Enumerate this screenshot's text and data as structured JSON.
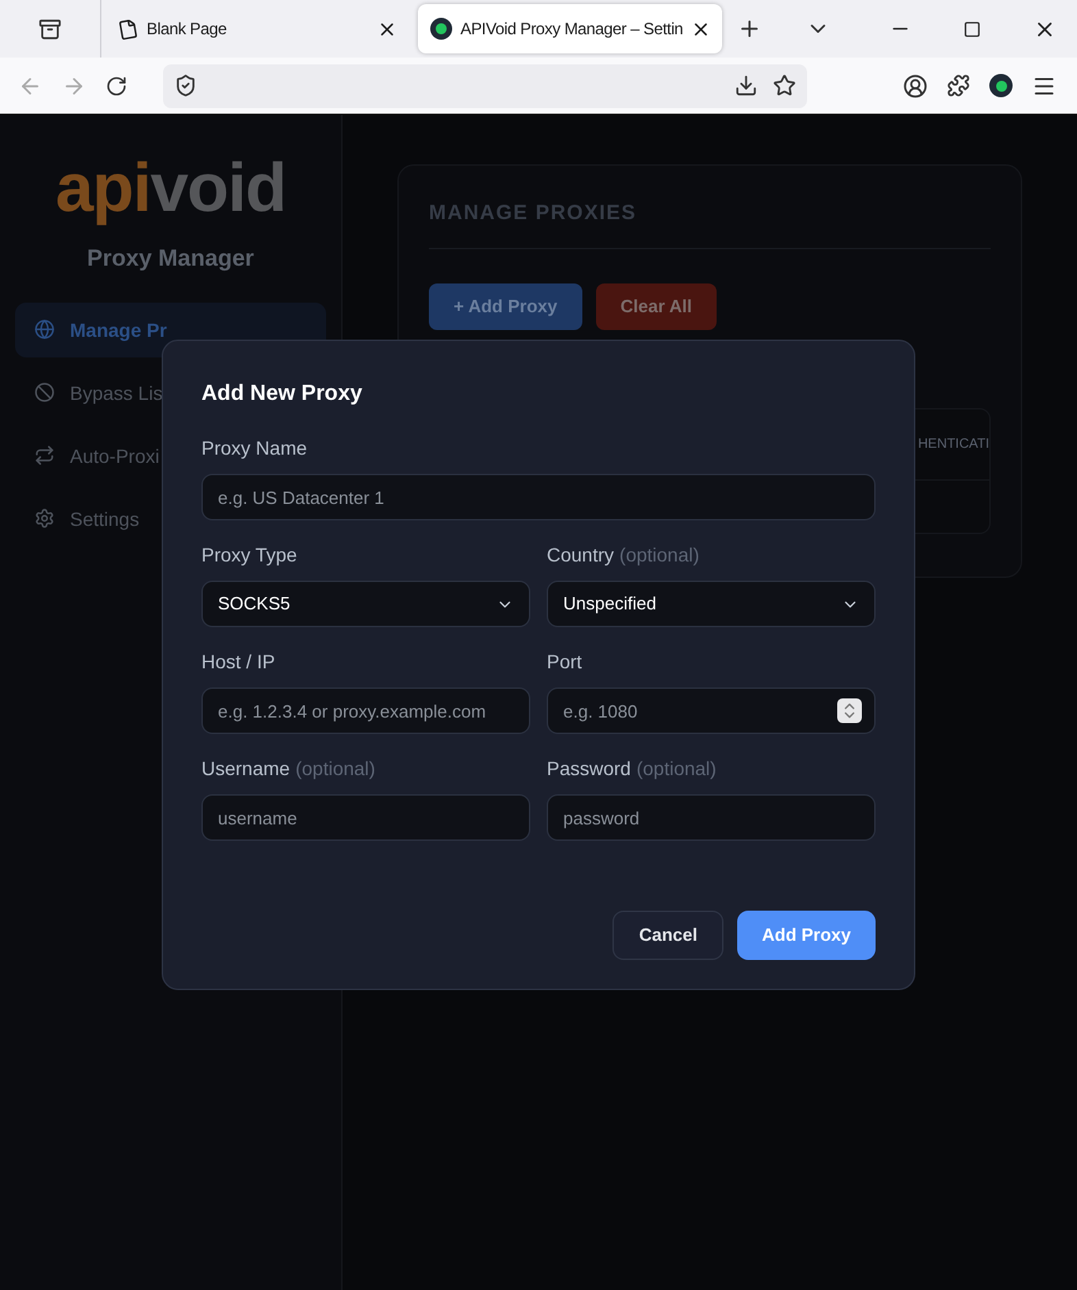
{
  "browser": {
    "tabs": [
      {
        "title": "Blank Page",
        "selected": false
      },
      {
        "title": "APIVoid Proxy Manager – Settin",
        "selected": true
      }
    ]
  },
  "sidebar": {
    "logo_accent": "api",
    "logo_rest": "void",
    "subtitle": "Proxy Manager",
    "items": [
      {
        "label": "Manage Pr",
        "selected": true
      },
      {
        "label": "Bypass Lis",
        "selected": false
      },
      {
        "label": "Auto-Proxi",
        "selected": false
      },
      {
        "label": "Settings",
        "selected": false
      }
    ]
  },
  "main": {
    "title": "MANAGE PROXIES",
    "buttons": [
      {
        "label": "+ Add Proxy",
        "kind": "primary"
      },
      {
        "label": "Clear All",
        "kind": "danger"
      }
    ],
    "table": {
      "column_header": "HENTICATI"
    }
  },
  "dialog": {
    "title": "Add New Proxy",
    "rows": [
      [
        {
          "kind": "text",
          "label": "Proxy Name",
          "placeholder": "e.g. US Datacenter 1"
        }
      ],
      [
        {
          "kind": "select",
          "label": "Proxy Type",
          "value": "SOCKS5"
        },
        {
          "kind": "select",
          "label": "Country",
          "note": "(optional)",
          "value": "Unspecified"
        }
      ],
      [
        {
          "kind": "text",
          "label": "Host / IP",
          "placeholder": "e.g. 1.2.3.4 or proxy.example.com"
        },
        {
          "kind": "number",
          "label": "Port",
          "placeholder": "e.g. 1080"
        }
      ],
      [
        {
          "kind": "text",
          "label": "Username",
          "note": "(optional)",
          "placeholder": "username"
        },
        {
          "kind": "password",
          "label": "Password",
          "note": "(optional)",
          "placeholder": "password"
        }
      ]
    ],
    "buttons": [
      {
        "label": "Cancel",
        "kind": "secondary"
      },
      {
        "label": "Add Proxy",
        "kind": "primary"
      }
    ]
  }
}
